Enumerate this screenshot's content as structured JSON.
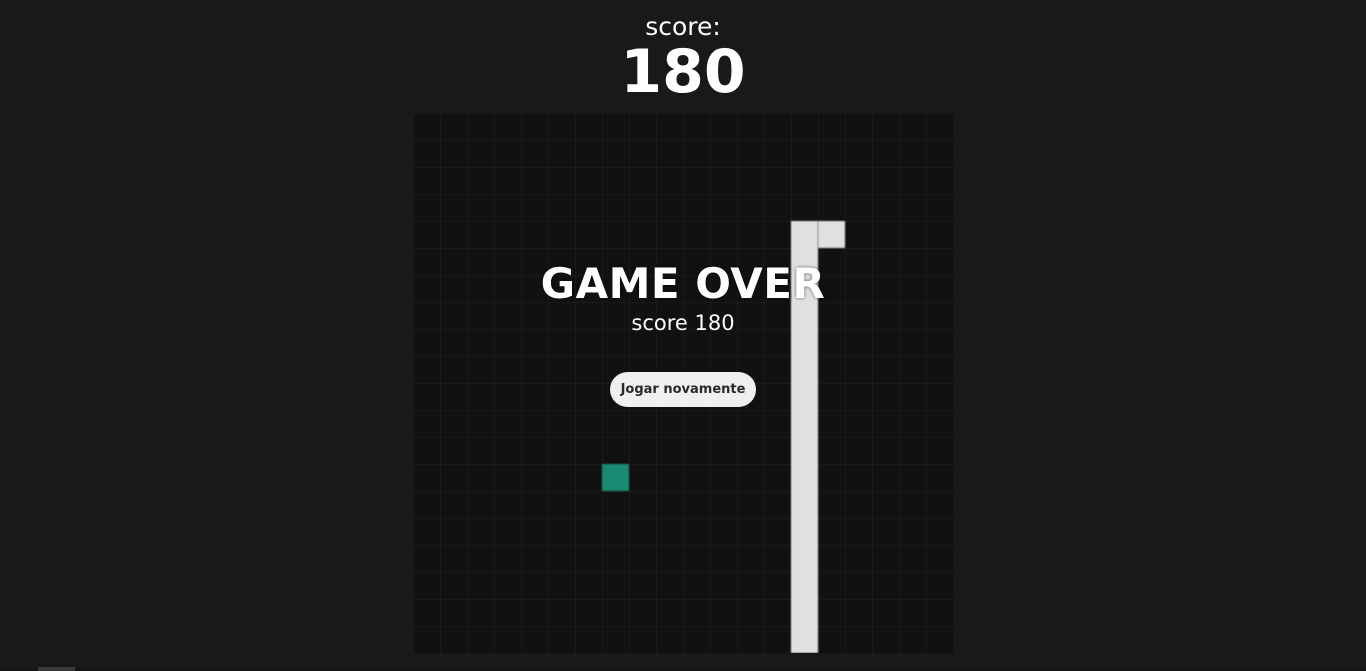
{
  "header": {
    "score_label": "score:",
    "score_value": "180"
  },
  "game_over": {
    "title": "GAME OVER",
    "score_text": "score 180",
    "play_again_label": "Jogar novamente"
  },
  "colors": {
    "background": "#191919",
    "board": "#111111",
    "snake": "#e0e0e0",
    "food": "#1a8a72",
    "button": "#f0f0f0"
  }
}
